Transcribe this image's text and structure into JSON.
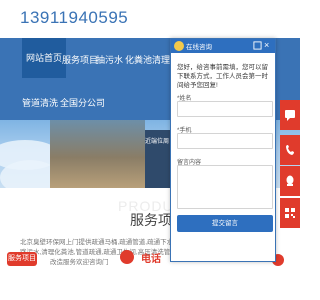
{
  "header": {
    "phone": "13911940595"
  },
  "nav": {
    "items": [
      {
        "label": "网站首页",
        "active": true
      },
      {
        "label": "服务项目",
        "active": false
      },
      {
        "label": "抽污水",
        "active": false
      },
      {
        "label": "化粪池清理",
        "active": false
      },
      {
        "label": "管道清洗",
        "active": false
      },
      {
        "label": "全国分公司",
        "active": false
      }
    ]
  },
  "banner": {
    "caption": "近端位周"
  },
  "services": {
    "watermark": "PRODUC",
    "title": "服务项目",
    "desc_lines": [
      "北京臭壁环保网上门提供疏通马桶,疏通管道,疏通下水道,通下",
      "路污水,清理化粪池,管道疏通,疏通卫生间,高压清洗管道,管道",
      "改造服务欢迎咨询门"
    ]
  },
  "bottom": {
    "services_button": "服务项目",
    "call_label": "电话"
  },
  "chat": {
    "title": "在线咨询",
    "greeting": "您好，给咨事前需填，您可以留下联系方式，工作人员会第一时间给予您回复!",
    "name_label": "*姓名",
    "phone_label": "*手机",
    "message_label": "留言内容",
    "submit_label": "提交留言"
  },
  "colors": {
    "brand": "#3a73b5",
    "accent": "#e03b2c"
  }
}
